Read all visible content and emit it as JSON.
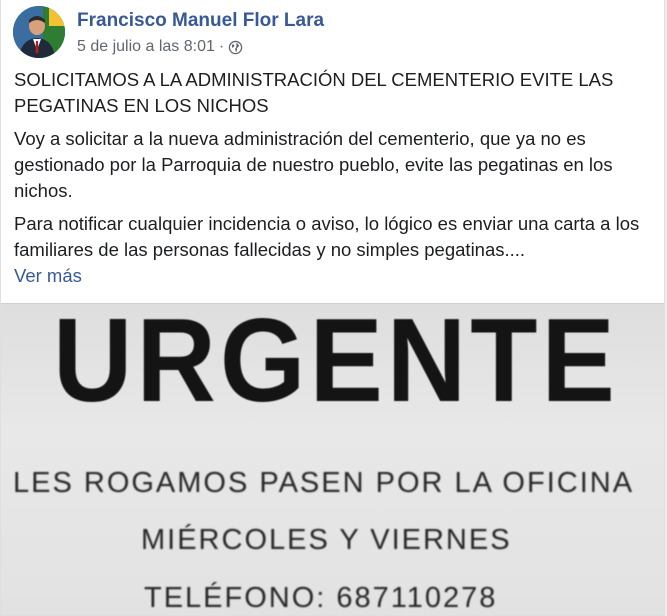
{
  "post": {
    "author": "Francisco Manuel Flor Lara",
    "timestamp": "5 de julio a las 8:01",
    "separator": "·",
    "privacy_icon": "globe-icon",
    "title": "SOLICITAMOS A LA ADMINISTRACIÓN DEL CEMENTERIO EVITE LAS PEGATINAS EN LOS NICHOS",
    "paragraph1": "Voy a solicitar a la nueva administración del cementerio, que ya no es gestionado por la Parroquia de nuestro pueblo, evite las pegatinas en los nichos.",
    "paragraph2": "Para notificar cualquier incidencia o aviso, lo lógico es enviar una carta a los familiares de las personas fallecidas y no simples pegatinas....",
    "see_more": "Ver más"
  },
  "photo": {
    "heading": "URGENTE",
    "line1": "LES ROGAMOS PASEN POR LA OFICINA",
    "line2": "MIÉRCOLES Y VIERNES",
    "line3": "TELÉFONO: 687110278"
  },
  "colors": {
    "author_link": "#385898",
    "meta_text": "#606770",
    "body_text": "#1c1e21"
  }
}
